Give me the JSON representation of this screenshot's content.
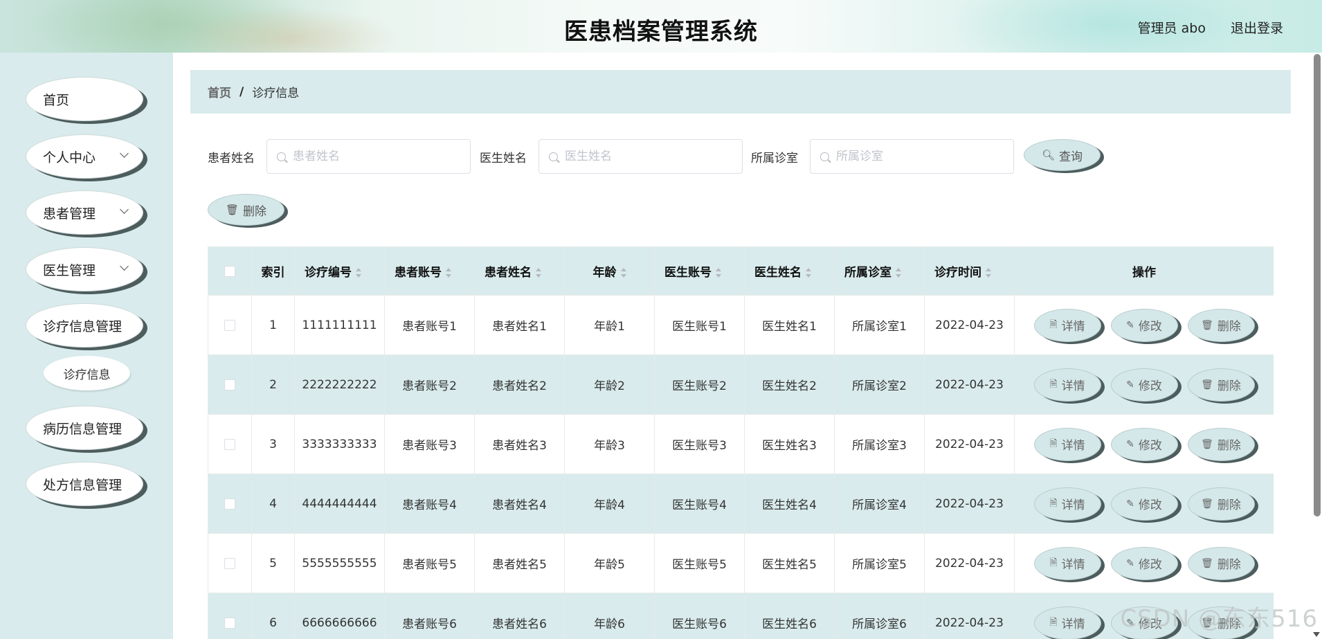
{
  "header": {
    "title": "医患档案管理系统",
    "user": "管理员 abo",
    "logout": "退出登录"
  },
  "sidebar": {
    "items": [
      {
        "label": "首页"
      },
      {
        "label": "个人中心"
      },
      {
        "label": "患者管理"
      },
      {
        "label": "医生管理"
      },
      {
        "label": "诊疗信息管理"
      },
      {
        "label": "病历信息管理"
      },
      {
        "label": "处方信息管理"
      }
    ],
    "sub_item": "诊疗信息"
  },
  "breadcrumb": {
    "home": "首页",
    "sep": "/",
    "current": "诊疗信息"
  },
  "search": {
    "patient_name_label": "患者姓名",
    "patient_name_placeholder": "患者姓名",
    "doctor_name_label": "医生姓名",
    "doctor_name_placeholder": "医生姓名",
    "clinic_label": "所属诊室",
    "clinic_placeholder": "所属诊室",
    "query_button": "查询",
    "delete_button": "删除"
  },
  "table": {
    "columns": [
      "索引",
      "诊疗编号",
      "患者账号",
      "患者姓名",
      "年龄",
      "医生账号",
      "医生姓名",
      "所属诊室",
      "诊疗时间",
      "操作"
    ],
    "actions": {
      "detail": "详情",
      "edit": "修改",
      "delete": "删除"
    },
    "rows": [
      {
        "index": "1",
        "code": "1111111111",
        "patient_account": "患者账号1",
        "patient_name": "患者姓名1",
        "age": "年龄1",
        "doctor_account": "医生账号1",
        "doctor_name": "医生姓名1",
        "clinic": "所属诊室1",
        "time": "2022-04-23"
      },
      {
        "index": "2",
        "code": "2222222222",
        "patient_account": "患者账号2",
        "patient_name": "患者姓名2",
        "age": "年龄2",
        "doctor_account": "医生账号2",
        "doctor_name": "医生姓名2",
        "clinic": "所属诊室2",
        "time": "2022-04-23"
      },
      {
        "index": "3",
        "code": "3333333333",
        "patient_account": "患者账号3",
        "patient_name": "患者姓名3",
        "age": "年龄3",
        "doctor_account": "医生账号3",
        "doctor_name": "医生姓名3",
        "clinic": "所属诊室3",
        "time": "2022-04-23"
      },
      {
        "index": "4",
        "code": "4444444444",
        "patient_account": "患者账号4",
        "patient_name": "患者姓名4",
        "age": "年龄4",
        "doctor_account": "医生账号4",
        "doctor_name": "医生姓名4",
        "clinic": "所属诊室4",
        "time": "2022-04-23"
      },
      {
        "index": "5",
        "code": "5555555555",
        "patient_account": "患者账号5",
        "patient_name": "患者姓名5",
        "age": "年龄5",
        "doctor_account": "医生账号5",
        "doctor_name": "医生姓名5",
        "clinic": "所属诊室5",
        "time": "2022-04-23"
      },
      {
        "index": "6",
        "code": "6666666666",
        "patient_account": "患者账号6",
        "patient_name": "患者姓名6",
        "age": "年龄6",
        "doctor_account": "医生账号6",
        "doctor_name": "医生姓名6",
        "clinic": "所属诊室6",
        "time": "2022-04-23"
      }
    ]
  },
  "watermark": "CSDN @东东516"
}
